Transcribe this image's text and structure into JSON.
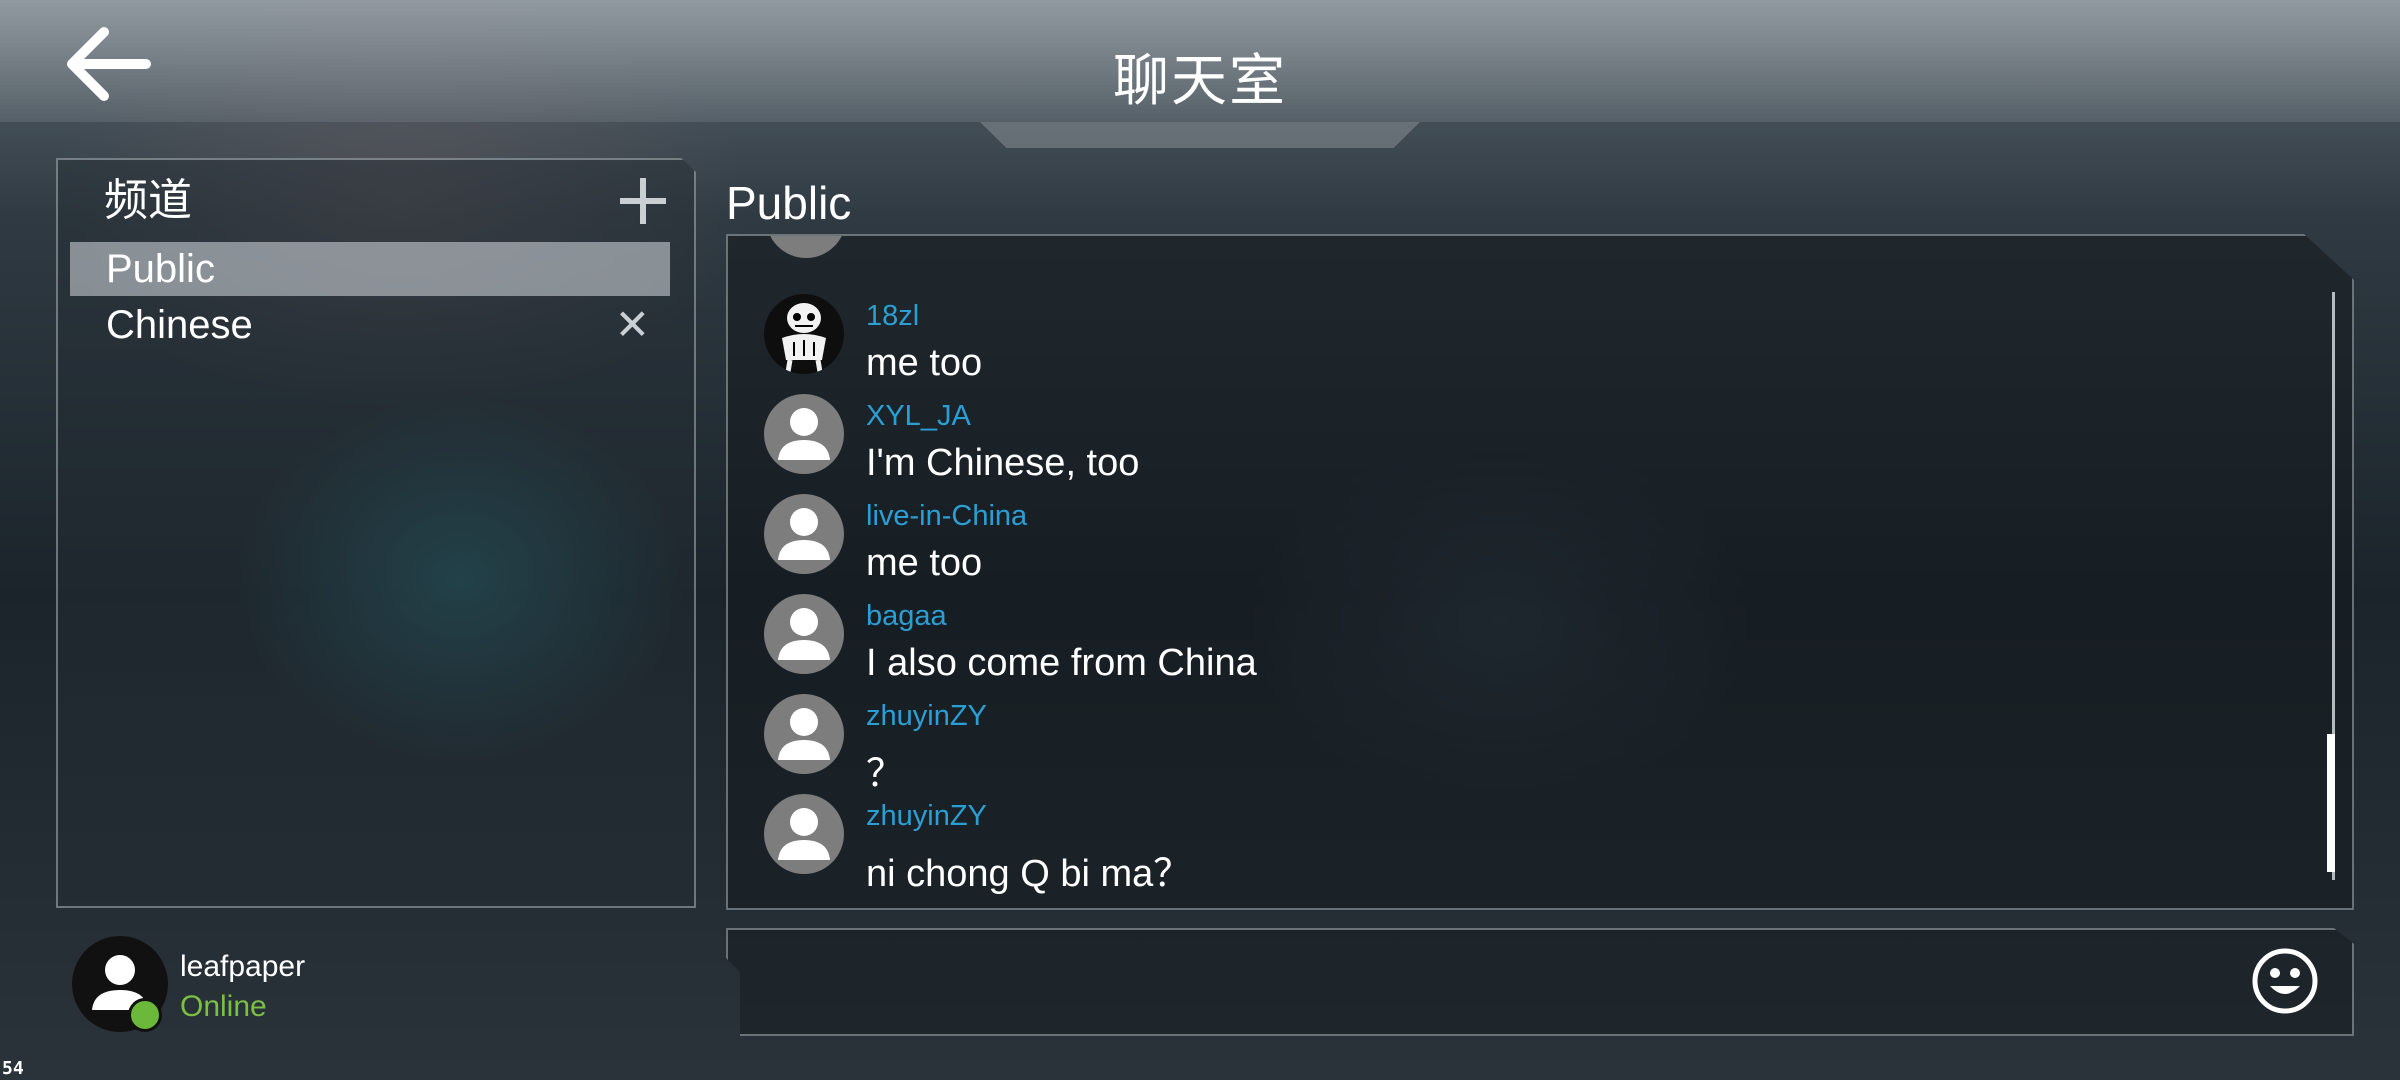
{
  "header": {
    "title": "聊天室"
  },
  "sidebar": {
    "title": "频道",
    "channels": [
      {
        "label": "Public"
      },
      {
        "label": "Chinese"
      }
    ]
  },
  "user": {
    "name": "leafpaper",
    "status": "Online"
  },
  "chat": {
    "channel_title": "Public",
    "messages": [
      {
        "user": "18zl",
        "text": "me too"
      },
      {
        "user": "XYL_JA",
        "text": "I'm Chinese, too"
      },
      {
        "user": "live-in-China",
        "text": "me too"
      },
      {
        "user": "bagaa",
        "text": "I also come from China"
      },
      {
        "user": "zhuyinZY",
        "text": "？"
      },
      {
        "user": "zhuyinZY",
        "text": "ni chong Q bi ma？"
      }
    ]
  },
  "fps": "54",
  "colors": {
    "username": "#2a9fd6",
    "online": "#7bc043"
  },
  "icons": [
    "back-arrow-icon",
    "plus-icon",
    "close-icon",
    "user-avatar-icon",
    "skeleton-avatar-icon",
    "smiley-icon"
  ]
}
